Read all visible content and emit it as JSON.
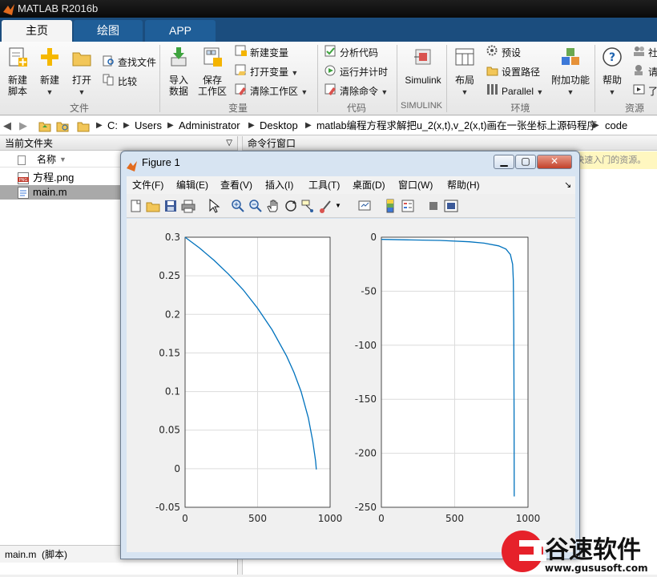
{
  "app": {
    "title": "MATLAB R2016b"
  },
  "tabs": [
    "主页",
    "绘图",
    "APP"
  ],
  "toolstrip": {
    "file": {
      "new_script": "新建\n脚本",
      "new": "新建",
      "open": "打开",
      "find_files": "查找文件",
      "compare": "比较",
      "group": "文件"
    },
    "variable": {
      "import": "导入\n数据",
      "save_ws": "保存\n工作区",
      "new_var": "新建变量",
      "open_var": "打开变量",
      "clear_ws": "清除工作区",
      "group": "变量"
    },
    "code": {
      "analyze": "分析代码",
      "run_time": "运行并计时",
      "clear_cmd": "清除命令",
      "group": "代码"
    },
    "simulink": {
      "label": "Simulink",
      "group": "SIMULINK"
    },
    "env": {
      "layout": "布局",
      "prefs": "预设",
      "set_path": "设置路径",
      "parallel": "Parallel",
      "addons": "附加功能",
      "group": "环境"
    },
    "resources": {
      "help": "帮助",
      "community": "社",
      "request": "请",
      "learn": "了",
      "group": "资源"
    }
  },
  "address": {
    "segments": [
      "C:",
      "Users",
      "Administrator",
      "Desktop",
      "matlab编程方程求解把u_2(x,t),v_2(x,t)画在一张坐标上源码程序",
      "code"
    ]
  },
  "file_panel": {
    "title": "当前文件夹",
    "column": "名称",
    "files": [
      {
        "name": "方程.png",
        "icon": "png-file-icon"
      },
      {
        "name": "main.m",
        "icon": "m-file-icon",
        "selected": true
      }
    ],
    "status": "main.m  (脚本)"
  },
  "command_panel": {
    "title": "命令行窗口",
    "hint": "不熟悉 MATLAB？请参阅有关快速入门的资源。"
  },
  "figure": {
    "title": "Figure 1",
    "menu": [
      "文件(F)",
      "编辑(E)",
      "查看(V)",
      "插入(I)",
      "工具(T)",
      "桌面(D)",
      "窗口(W)",
      "帮助(H)"
    ]
  },
  "chart_data": [
    {
      "type": "line",
      "title": "",
      "xlabel": "",
      "ylabel": "",
      "xlim": [
        0,
        1000
      ],
      "ylim": [
        -0.05,
        0.3
      ],
      "xticks": [
        "0",
        "500",
        "1000"
      ],
      "yticks": [
        "0.3",
        "0.25",
        "0.2",
        "0.15",
        "0.1",
        "0.05",
        "0",
        "-0.05"
      ],
      "grid": true,
      "color": "#0072bd",
      "series": [
        {
          "x": [
            0,
            100,
            200,
            300,
            400,
            500,
            600,
            700,
            750,
            800,
            850,
            880,
            900,
            905
          ],
          "y": [
            0.3,
            0.286,
            0.27,
            0.252,
            0.232,
            0.208,
            0.18,
            0.146,
            0.125,
            0.1,
            0.066,
            0.036,
            0.01,
            -0.001
          ]
        }
      ]
    },
    {
      "type": "line",
      "title": "",
      "xlabel": "",
      "ylabel": "",
      "xlim": [
        0,
        1000
      ],
      "ylim": [
        -250,
        0
      ],
      "xticks": [
        "0",
        "500",
        "1000"
      ],
      "yticks": [
        "0",
        "-50",
        "-100",
        "-150",
        "-200",
        "-250"
      ],
      "grid": true,
      "color": "#0072bd",
      "series": [
        {
          "x": [
            0,
            200,
            400,
            600,
            700,
            800,
            850,
            880,
            895,
            900,
            903,
            905,
            906
          ],
          "y": [
            -2,
            -2.5,
            -3,
            -4.2,
            -5.5,
            -8,
            -11,
            -16,
            -25,
            -40,
            -80,
            -160,
            -240
          ]
        }
      ]
    }
  ],
  "watermark": {
    "brand": "谷速软件",
    "url": "www.gususoft.com",
    "color": "#e6212a"
  }
}
